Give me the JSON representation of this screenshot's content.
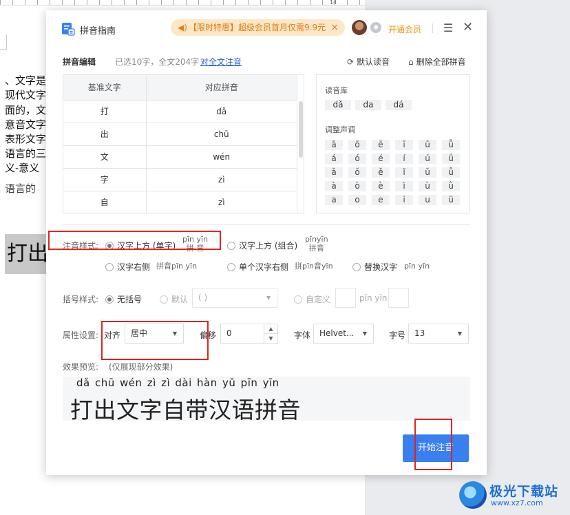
{
  "document": {
    "ruler_mark": "14",
    "lines": [
      "、文字是",
      "现代文字",
      "面的，文",
      "意音文字",
      "表形文字",
      "语言的三",
      "义-意义",
      "语言的"
    ],
    "highlight_text": "打出"
  },
  "dialog": {
    "title": "拼音指南",
    "promo_text": "【限时特惠】超级会员首月仅需9.9元",
    "promo_close": "×",
    "vip_link": "开通会员",
    "vip_icon": "◆",
    "menu_icon": "☰",
    "close_icon": "✕"
  },
  "edit": {
    "label": "拼音编辑",
    "info": "已选10字，全文204字",
    "link": "对全文注音",
    "reset_label": "默认读音",
    "reset_icon": "⟳",
    "delete_label": "删除全部拼音",
    "delete_icon": "🗑"
  },
  "table": {
    "headers": [
      "基准文字",
      "对应拼音"
    ],
    "rows": [
      {
        "char": "打",
        "pinyin": "dǎ"
      },
      {
        "char": "出",
        "pinyin": "chū"
      },
      {
        "char": "文",
        "pinyin": "wén"
      },
      {
        "char": "字",
        "pinyin": "zì"
      },
      {
        "char": "自",
        "pinyin": "zì"
      }
    ]
  },
  "library": {
    "title": "读音库",
    "readings": [
      "dǎ",
      "da",
      "dá"
    ],
    "tone_title": "调整声调",
    "tones": [
      [
        "ā",
        "ō",
        "ē",
        "ī",
        "ū",
        "ǖ"
      ],
      [
        "á",
        "ó",
        "é",
        "í",
        "ú",
        "ǘ"
      ],
      [
        "ǎ",
        "ǒ",
        "ě",
        "ǐ",
        "ǔ",
        "ǚ"
      ],
      [
        "à",
        "ò",
        "è",
        "ì",
        "ù",
        "ǜ"
      ],
      [
        "a",
        "o",
        "e",
        "i",
        "u",
        "ü"
      ]
    ]
  },
  "style": {
    "label": "注音样式:",
    "opt_top": "汉字上方 (单字)",
    "sample_top_pinyin": "pīn yīn",
    "sample_top_chars": "拼 音",
    "opt_top_group": "汉字上方 (组合)",
    "sample_group_pinyin": "pīnyīn",
    "sample_group_chars": "拼音",
    "opt_right": "汉字右侧",
    "sample_right": "拼音pīn yīn",
    "opt_single_right": "单个汉字右侧",
    "sample_single_right": "拼pīn音yīn",
    "opt_replace": "替换汉字",
    "sample_replace": "pīn yīn"
  },
  "bracket": {
    "label": "括号样式:",
    "opt_none": "无括号",
    "opt_default": "默认",
    "default_value": "( )",
    "opt_custom": "自定义",
    "custom_sample": "pīn yīn"
  },
  "attrs": {
    "label": "属性设置:",
    "align_label": "对齐",
    "align_value": "居中",
    "offset_label": "偏移",
    "offset_value": "0",
    "font_label": "字体",
    "font_value": "Helvet...",
    "size_label": "字号",
    "size_value": "13"
  },
  "preview": {
    "label": "效果预览:",
    "note": "(仅展现部分效果)",
    "pinyin": "dǎ  chū wén  zì   zì  dài  hàn  yǔ  pīn  yīn",
    "text": "打出文字自带汉语拼音"
  },
  "start_button": "开始注音",
  "watermark": {
    "title": "极光下载站",
    "url": "www.xz7.com"
  },
  "colors": {
    "accent": "#3a7ff0",
    "highlight_box": "#e1231f",
    "promo": "#e07b10"
  }
}
